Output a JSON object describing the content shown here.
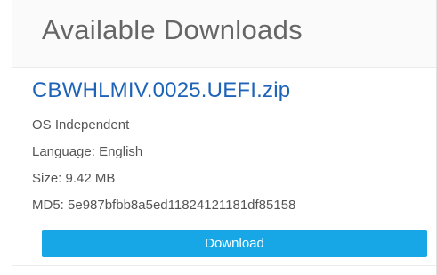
{
  "panel": {
    "title": "Available Downloads",
    "file_name": "CBWHLMIV.0025.UEFI.zip",
    "details": [
      "OS Independent",
      "Language: English",
      "Size: 9.42 MB",
      "MD5: 5e987bfbb8a5ed11824121181df85158"
    ],
    "download_label": "Download",
    "colors": {
      "link": "#1d63b8",
      "button": "#17a7e6",
      "button_text": "#ffffff",
      "title": "#666666",
      "detail_text": "#555555"
    }
  }
}
